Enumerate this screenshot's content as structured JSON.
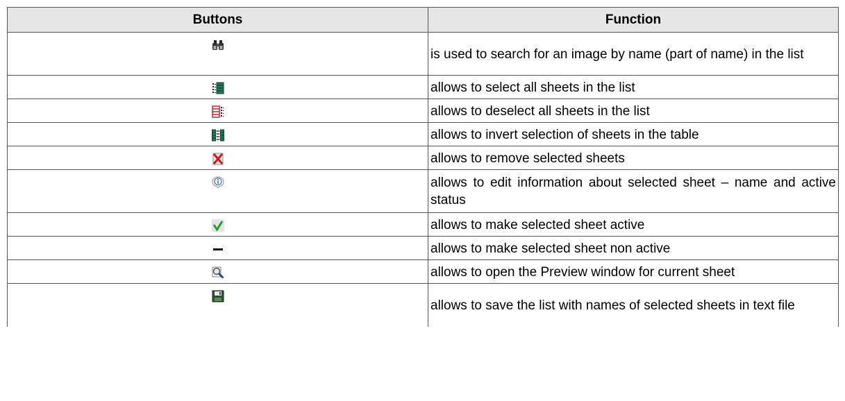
{
  "table": {
    "headers": {
      "buttons": "Buttons",
      "function": "Function"
    },
    "rows": [
      {
        "icon": "binoculars-icon",
        "function": "is used to search for an image by name (part of name) in the list"
      },
      {
        "icon": "select-all-icon",
        "function": "allows to select all sheets in the list"
      },
      {
        "icon": "deselect-all-icon",
        "function": "allows to deselect all sheets in the list"
      },
      {
        "icon": "invert-selection-icon",
        "function": "allows to invert selection of sheets in the table"
      },
      {
        "icon": "remove-icon",
        "function": "allows to remove selected sheets"
      },
      {
        "icon": "info-icon",
        "function": "allows to edit information about selected sheet – name and active status"
      },
      {
        "icon": "checkmark-icon",
        "function": "allows to make selected sheet active"
      },
      {
        "icon": "minus-icon",
        "function": "allows to make selected sheet non active"
      },
      {
        "icon": "magnifier-icon",
        "function": "allows to open the Preview window for current sheet"
      },
      {
        "icon": "save-icon",
        "function": "allows to save the list with names of selected sheets in text file"
      }
    ]
  },
  "colors": {
    "header_bg": "#e6e6e6",
    "border": "#555555",
    "select_green": "#1f7a5c",
    "deselect_red": "#cc2233",
    "check_green": "#2a9a2a",
    "info_blue": "#2a5fd0"
  }
}
